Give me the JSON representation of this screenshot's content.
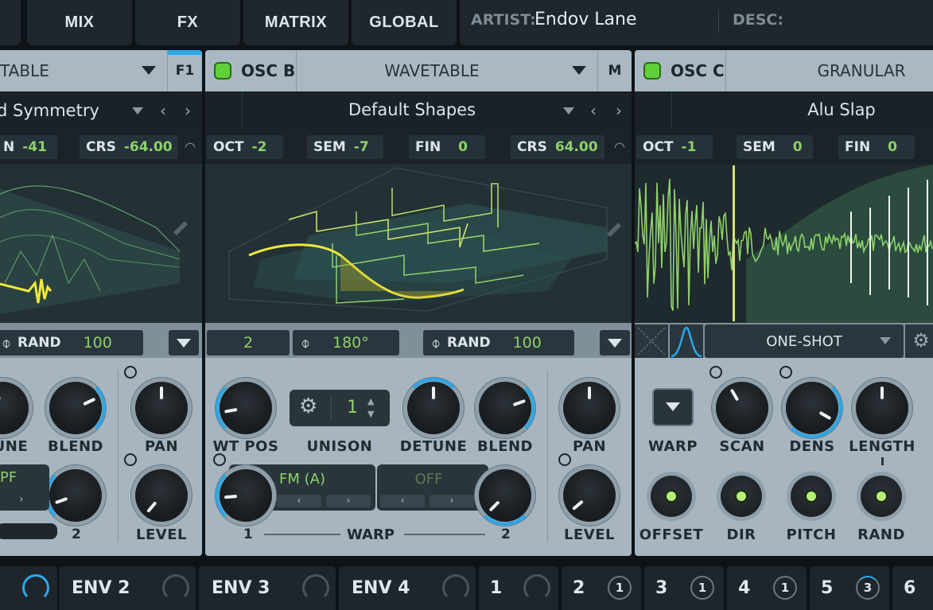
{
  "top_tabs": [
    "MIX",
    "FX",
    "MATRIX",
    "GLOBAL"
  ],
  "artist_label": "ARTIST:",
  "artist_value": "Endov Lane",
  "desc_label": "DESC:",
  "osc_a": {
    "type": "TABLE",
    "filter_btn": "F1",
    "preset": "d Symmetry",
    "fin_label": "N",
    "fin_value": "-41",
    "crs_label": "CRS",
    "crs_value": "-64.00",
    "rand_label": "RAND",
    "rand_value": "100",
    "knob_labels": [
      "TUNE",
      "BLEND",
      "PAN",
      "LEVEL"
    ],
    "warp_label": "PF",
    "warp_right": "2"
  },
  "osc_b": {
    "name": "OSC B",
    "type": "WAVETABLE",
    "mode_btn": "M",
    "preset": "Default Shapes",
    "oct_label": "OCT",
    "oct_value": "-2",
    "sem_label": "SEM",
    "sem_value": "-7",
    "fin_label": "FIN",
    "fin_value": "0",
    "crs_label": "CRS",
    "crs_value": "64.00",
    "bottom_value": "2",
    "phase_value": "180°",
    "rand_label": "RAND",
    "rand_value": "100",
    "unison_value": "1",
    "knob_labels": [
      "WT POS",
      "UNISON",
      "DETUNE",
      "BLEND",
      "PAN",
      "LEVEL"
    ],
    "warp1_mode": "FM (A)",
    "warp2_mode": "OFF",
    "warp_left": "1",
    "warp_label": "WARP",
    "warp_right": "2"
  },
  "osc_c": {
    "name": "OSC C",
    "type": "GRANULAR",
    "preset": "Alu Slap",
    "oct_label": "OCT",
    "oct_value": "-1",
    "sem_label": "SEM",
    "sem_value": "0",
    "fin_label": "FIN",
    "fin_value": "0",
    "play_mode": "ONE-SHOT",
    "knob_labels": [
      "WARP",
      "SCAN",
      "DENS",
      "LENGTH",
      "OFFSET",
      "DIR",
      "PITCH",
      "RAND"
    ]
  },
  "env_tabs": [
    "ENV 2",
    "ENV 3",
    "ENV 4"
  ],
  "lfo_tabs": [
    {
      "n": "1",
      "badge": ""
    },
    {
      "n": "2",
      "badge": "1"
    },
    {
      "n": "3",
      "badge": "1"
    },
    {
      "n": "4",
      "badge": "1"
    },
    {
      "n": "5",
      "badge": "3"
    },
    {
      "n": "6",
      "badge": ""
    }
  ],
  "colors": {
    "accent_green": "#8fd16a",
    "led_green": "#5fcf3a",
    "accent_blue": "#2aa8e8",
    "wave_yellow": "#f0e83a"
  }
}
